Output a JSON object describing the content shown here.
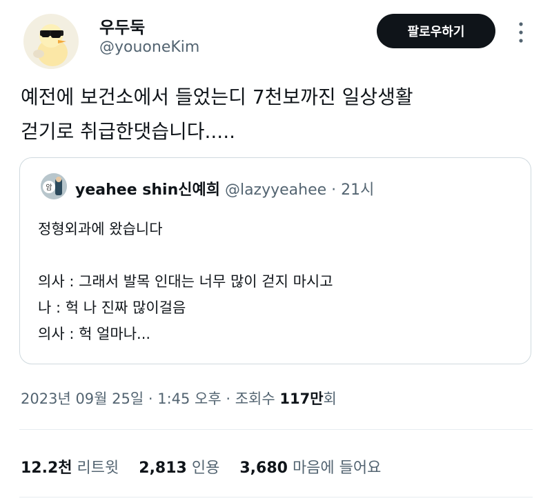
{
  "author": {
    "display_name": "우두둑",
    "handle": "@youoneKim"
  },
  "follow_button": {
    "label": "팔로우하기"
  },
  "tweet": {
    "lines": [
      "예전에 보건소에서 들었는디 7천보까진 일상생활",
      "걷기로 취급한댓습니다....."
    ]
  },
  "quote": {
    "avatar_text": "암",
    "name": "yeahee shin신예희",
    "handle": "@lazyyeahee",
    "time": "21시",
    "lines": [
      "정형외과에 왔습니다",
      "",
      "의사 : 그래서 발목 인대는 너무 많이 걷지 마시고",
      "나 : 헉 나 진짜 많이걸음",
      "의사 : 헉 얼마나..."
    ]
  },
  "timestamp": {
    "text": "2023년 09월 25일 · 1:45 오후 · 조회수 ",
    "views_num": "117만",
    "views_unit": "회"
  },
  "stats": {
    "retweets_num": "12.2천",
    "retweets_label": "리트윗",
    "quotes_num": "2,813",
    "quotes_label": "인용",
    "likes_num": "3,680",
    "likes_label": "마음에 들어요"
  },
  "icons": {
    "avatar": "duck-sunglasses-avatar-icon",
    "more": "more-vertical-icon"
  },
  "colors": {
    "text_primary": "#0f1419",
    "text_secondary": "#536471",
    "button_bg": "#0f1419",
    "border": "#cfd9de"
  }
}
